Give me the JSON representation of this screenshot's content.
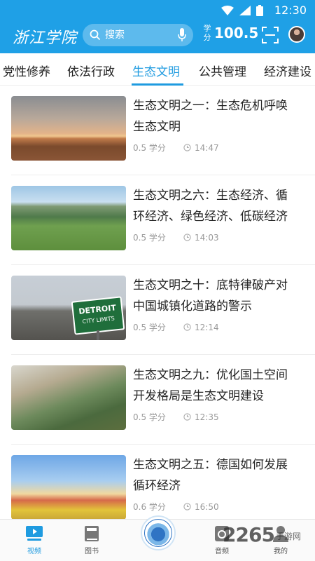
{
  "status_bar": {
    "time": "12:30"
  },
  "app_bar": {
    "logo_text": "浙江学院",
    "search_placeholder": "搜索",
    "credit_label": "学分",
    "credit_value": "100.5"
  },
  "tabs": [
    {
      "label": "党性修养",
      "active": false
    },
    {
      "label": "依法行政",
      "active": false
    },
    {
      "label": "生态文明",
      "active": true
    },
    {
      "label": "公共管理",
      "active": false
    },
    {
      "label": "经济建设",
      "active": false
    }
  ],
  "videos": [
    {
      "title": "生态文明之一：生态危机呼唤生态文明",
      "credits": "0.5 学分",
      "duration": "14:47"
    },
    {
      "title": "生态文明之六：生态经济、循环经济、绿色经济、低碳经济",
      "credits": "0.5 学分",
      "duration": "14:03"
    },
    {
      "title": "生态文明之十：底特律破产对中国城镇化道路的警示",
      "credits": "0.5 学分",
      "duration": "12:14",
      "sign_line1": "DETROIT",
      "sign_line2": "CITY LIMITS"
    },
    {
      "title": "生态文明之九：优化国土空间开发格局是生态文明建设",
      "credits": "0.5 学分",
      "duration": "12:35"
    },
    {
      "title": "生态文明之五：德国如何发展循环经济",
      "credits": "0.6 学分",
      "duration": "16:50"
    }
  ],
  "bottom_nav": [
    {
      "label": "视频",
      "active": true
    },
    {
      "label": "图书",
      "active": false
    },
    {
      "label": "音频",
      "active": false
    },
    {
      "label": "我的",
      "active": false
    }
  ],
  "watermark": {
    "main": "2265",
    "sub": "手游网"
  },
  "colors": {
    "primary": "#1fa0e6",
    "active_tab": "#1f9be0",
    "meta_text": "#999999"
  }
}
